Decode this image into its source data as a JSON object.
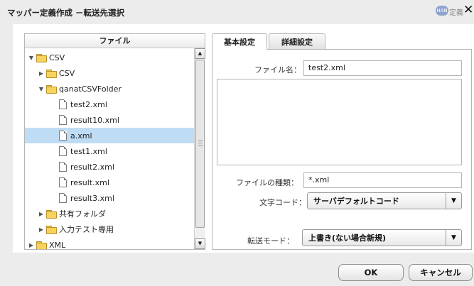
{
  "dialog": {
    "title": "マッパー定義作成 －転送先選択",
    "help_badge": "HAN",
    "help_label": "定義",
    "close_glyph": "✕"
  },
  "tree": {
    "header": "ファイル",
    "items": [
      {
        "label": "CSV",
        "type": "folder",
        "expanded": true,
        "level": 0
      },
      {
        "label": "CSV",
        "type": "folder",
        "expanded": false,
        "level": 1
      },
      {
        "label": "qanatCSVFolder",
        "type": "folder",
        "expanded": true,
        "level": 1
      },
      {
        "label": "test2.xml",
        "type": "file",
        "level": 2
      },
      {
        "label": "result10.xml",
        "type": "file",
        "level": 2
      },
      {
        "label": "a.xml",
        "type": "file",
        "level": 2,
        "selected": true
      },
      {
        "label": "test1.xml",
        "type": "file",
        "level": 2
      },
      {
        "label": "result2.xml",
        "type": "file",
        "level": 2
      },
      {
        "label": "result.xml",
        "type": "file",
        "level": 2
      },
      {
        "label": "result3.xml",
        "type": "file",
        "level": 2
      },
      {
        "label": "共有フォルダ",
        "type": "folder",
        "expanded": false,
        "level": 1
      },
      {
        "label": "入力テスト専用",
        "type": "folder",
        "expanded": false,
        "level": 1
      },
      {
        "label": "XML",
        "type": "folder",
        "expanded": false,
        "level": 0
      }
    ],
    "selected_color": "#bfdcf5"
  },
  "tabs": [
    {
      "label": "基本設定",
      "active": true
    },
    {
      "label": "詳細設定",
      "active": false
    }
  ],
  "form": {
    "filename_label": "ファイル名：",
    "filename_value": "test2.xml",
    "filetype_label": "ファイルの種類：",
    "filetype_value": "*.xml",
    "charset_label": "文字コード：",
    "charset_value": "サーバデフォルトコード",
    "transfer_label": "転送モード：",
    "transfer_value": "上書き(ない場合新規)"
  },
  "buttons": {
    "ok": "OK",
    "cancel": "キャンセル"
  }
}
